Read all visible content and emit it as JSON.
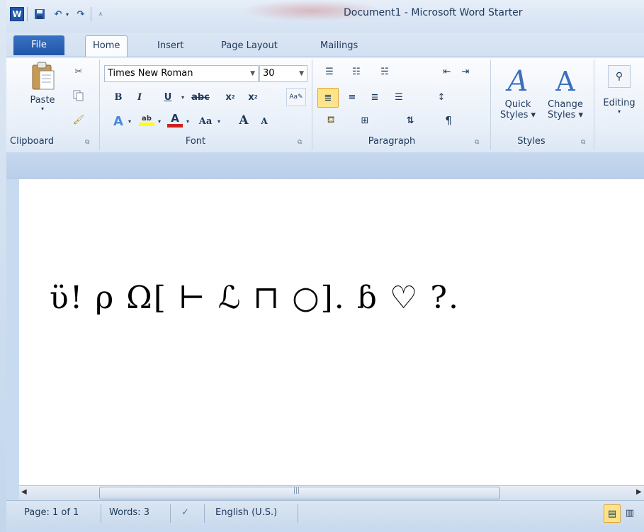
{
  "window": {
    "title": "Document1  -  Microsoft Word Starter",
    "app_icon": "W"
  },
  "quick_access": {
    "save_icon": "save-icon",
    "undo_icon": "undo-icon",
    "redo_icon": "redo-icon",
    "customize_icon": "customize-qat-icon"
  },
  "tabs": {
    "file": "File",
    "home": "Home",
    "insert": "Insert",
    "page_layout": "Page Layout",
    "mailings": "Mailings"
  },
  "clipboard": {
    "paste_label": "Paste",
    "group_label": "Clipboard"
  },
  "font": {
    "name": "Times New Roman",
    "size": "30",
    "group_label": "Font",
    "bold": "B",
    "italic": "I",
    "underline": "U",
    "strikethrough": "abc",
    "subscript": "x",
    "superscript": "x",
    "change_case": "Aa",
    "grow": "A",
    "shrink": "A"
  },
  "paragraph": {
    "group_label": "Paragraph",
    "pilcrow": "¶"
  },
  "styles": {
    "quick_styles_line1": "Quick",
    "quick_styles_line2": "Styles",
    "change_styles_line1": "Change",
    "change_styles_line2": "Styles",
    "group_label": "Styles"
  },
  "editing": {
    "label": "Editing"
  },
  "document": {
    "text": "ϋ! ρ Ω[ ⊢ ℒ ⊓ ○]. ɓ ♡ ?."
  },
  "statusbar": {
    "page": "Page: 1 of 1",
    "words": "Words: 3",
    "language": "English (U.S.)"
  },
  "colors": {
    "file_tab": "#2a62b8",
    "accent_red": "#cc2222",
    "highlight_yellow": "#ffff00",
    "ribbon_text": "#1e395b"
  }
}
